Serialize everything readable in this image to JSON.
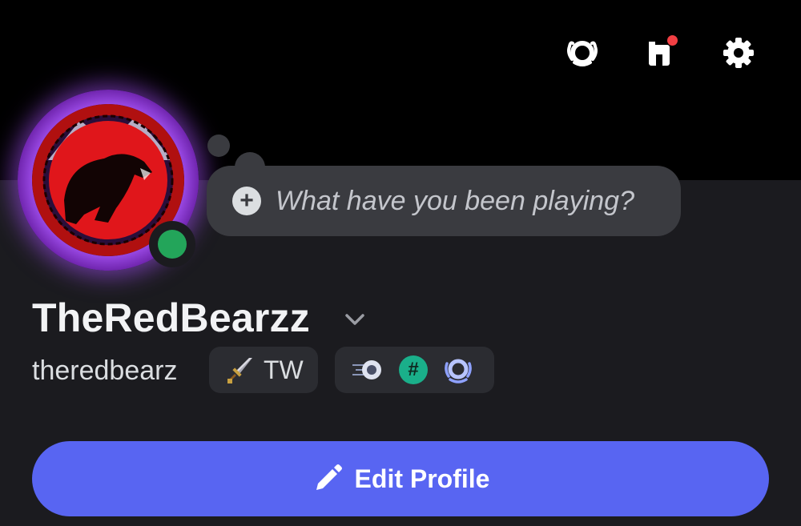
{
  "header": {
    "icons": [
      "nitro-laurel-icon",
      "shop-icon",
      "settings-gear-icon"
    ],
    "shop_notification": true
  },
  "profile": {
    "avatar": "red-bear-avatar",
    "status": "online",
    "status_color": "#23a55a",
    "custom_status_placeholder": "What have you been playing?",
    "display_name": "TheRedBearzz",
    "username": "theredbearz",
    "tag": {
      "icon": "sword-icon",
      "text": "TW"
    },
    "badges": [
      "speed-orb-badge",
      "hashtag-badge",
      "nitro-laurel-badge"
    ]
  },
  "actions": {
    "edit_profile_label": "Edit Profile"
  },
  "colors": {
    "accent": "#5865f2",
    "background": "#1b1b1f",
    "banner": "#000000",
    "avatar_ring": "#a855f7"
  }
}
